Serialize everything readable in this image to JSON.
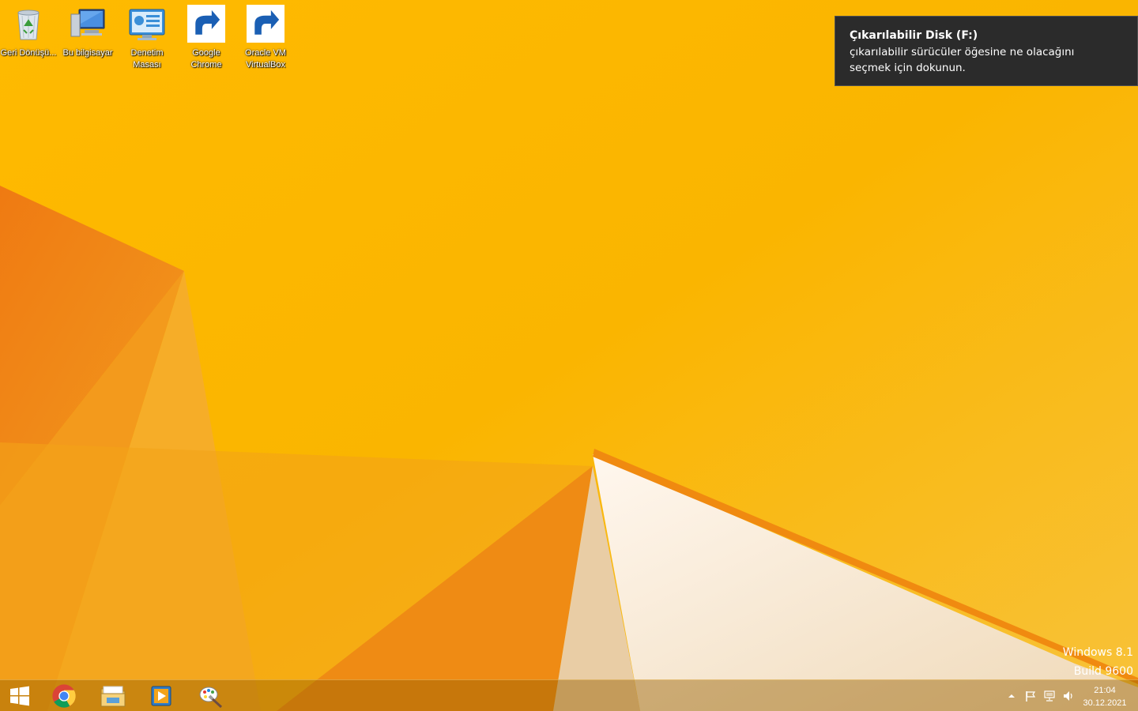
{
  "desktop": {
    "icons": [
      {
        "label": "Geri Dönüşü...",
        "icon": "recycle-bin-icon"
      },
      {
        "label": "Bu bilgisayar",
        "icon": "computer-icon"
      },
      {
        "label": "Denetim Masası",
        "icon": "control-panel-icon"
      },
      {
        "label": "Google Chrome",
        "icon": "chrome-icon"
      },
      {
        "label": "Oracle VM VirtualBox",
        "icon": "virtualbox-icon"
      }
    ]
  },
  "notification": {
    "title": "Çıkarılabilir Disk (F:)",
    "body": "çıkarılabilir sürücüler öğesine ne olacağını seçmek için dokunun."
  },
  "watermark": {
    "line1": "Windows 8.1",
    "line2": "Build 9600"
  },
  "taskbar": {
    "pinned": [
      {
        "icon": "windows-start-icon"
      },
      {
        "icon": "chrome-icon"
      },
      {
        "icon": "file-explorer-icon"
      },
      {
        "icon": "media-player-icon"
      },
      {
        "icon": "paint-icon"
      }
    ],
    "tray": {
      "icons": [
        "chevron-up-icon",
        "flag-icon",
        "network-icon",
        "volume-icon"
      ],
      "time": "21:04",
      "date": "30.12.2021"
    }
  },
  "colors": {
    "wallpaper_base": "#f7b000",
    "wallpaper_orange": "#ee7a10",
    "wallpaper_cream": "#f5e8d5",
    "toast_bg": "#2b2b2b"
  }
}
